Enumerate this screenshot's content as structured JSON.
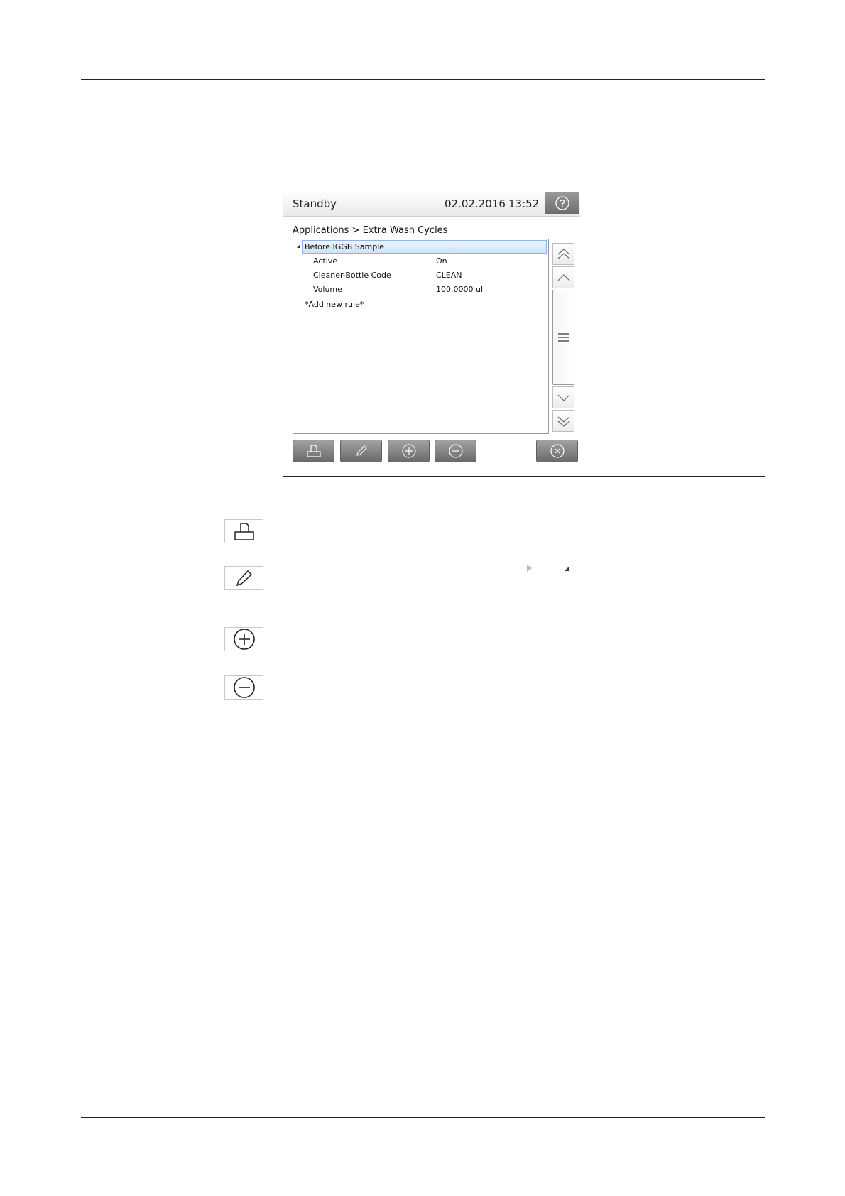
{
  "status_bar": {
    "state": "Standby",
    "date": "02.02.2016",
    "time": "13:52",
    "help_icon": "question-circle-icon"
  },
  "breadcrumb": "Applications > Extra Wash Cycles",
  "rule_list": {
    "group": {
      "label": "Before IGGB Sample",
      "expanded": true
    },
    "rows": [
      {
        "label": "Active",
        "value": "On"
      },
      {
        "label": "Cleaner-Bottle Code",
        "value": "CLEAN"
      },
      {
        "label": "Volume",
        "value": "100.0000 ul"
      }
    ],
    "add_rule_label": "*Add new rule*"
  },
  "scrollbar": {
    "top_icon": "double-chevron-up-icon",
    "up_icon": "chevron-up-icon",
    "thumb_icon": "grip-lines-icon",
    "down_icon": "chevron-down-icon",
    "bottom_icon": "double-chevron-down-icon"
  },
  "toolbar": {
    "buttons": [
      {
        "icon": "print-icon"
      },
      {
        "icon": "pencil-icon"
      },
      {
        "icon": "plus-circle-icon"
      },
      {
        "icon": "minus-circle-icon"
      },
      {
        "icon": "close-circle-icon"
      }
    ]
  },
  "legend": {
    "icons": [
      "print-icon",
      "pencil-icon",
      "plus-circle-icon",
      "minus-circle-icon"
    ],
    "glyphs": [
      "expand-triangle-icon",
      "collapse-triangle-icon"
    ]
  },
  "colors": {
    "selection_fill": "#cfe2fa",
    "selection_border": "#8fb4e6",
    "button_gray": "#6a6a6a"
  }
}
